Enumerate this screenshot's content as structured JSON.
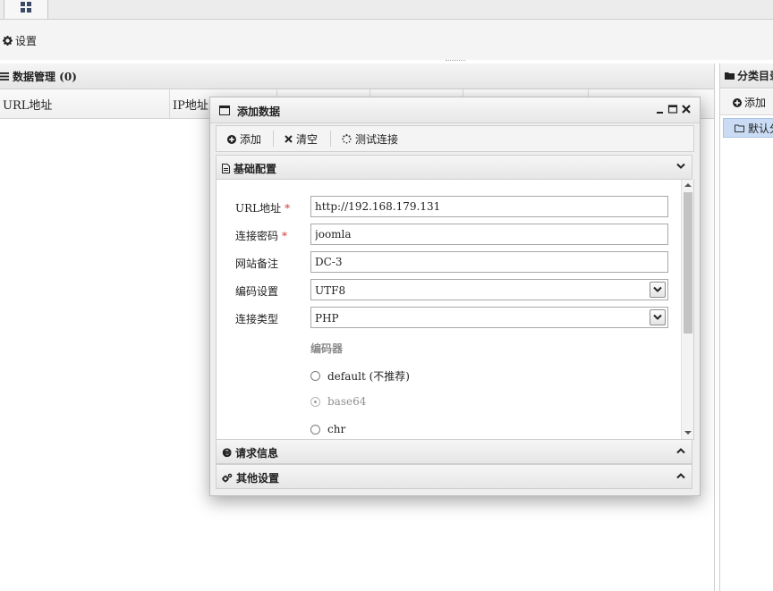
{
  "toolbar": {
    "settings_label": "设置"
  },
  "data_panel": {
    "title": "数据管理 (0)",
    "columns": [
      "URL地址",
      "IP地址",
      "",
      "",
      "",
      ""
    ]
  },
  "category_panel": {
    "title": "分类目录",
    "add_label": "添加",
    "default_item": "默认分类"
  },
  "dialog": {
    "title": "添加数据",
    "toolbar": {
      "add": "添加",
      "clear": "清空",
      "test": "测试连接"
    },
    "sections": {
      "basic": "基础配置",
      "request": "请求信息",
      "other": "其他设置"
    },
    "fields": {
      "url_label": "URL地址",
      "url_value": "http://192.168.179.131",
      "password_label": "连接密码",
      "password_value": "joomla",
      "note_label": "网站备注",
      "note_value": "DC-3",
      "encoding_label": "编码设置",
      "encoding_value": "UTF8",
      "type_label": "连接类型",
      "type_value": "PHP",
      "required_mark": "*"
    },
    "encoder": {
      "title": "编码器",
      "options": [
        {
          "label": "default (不推荐)",
          "state": "unchecked"
        },
        {
          "label": "base64",
          "state": "disabled"
        },
        {
          "label": "chr",
          "state": "unchecked"
        }
      ]
    }
  }
}
